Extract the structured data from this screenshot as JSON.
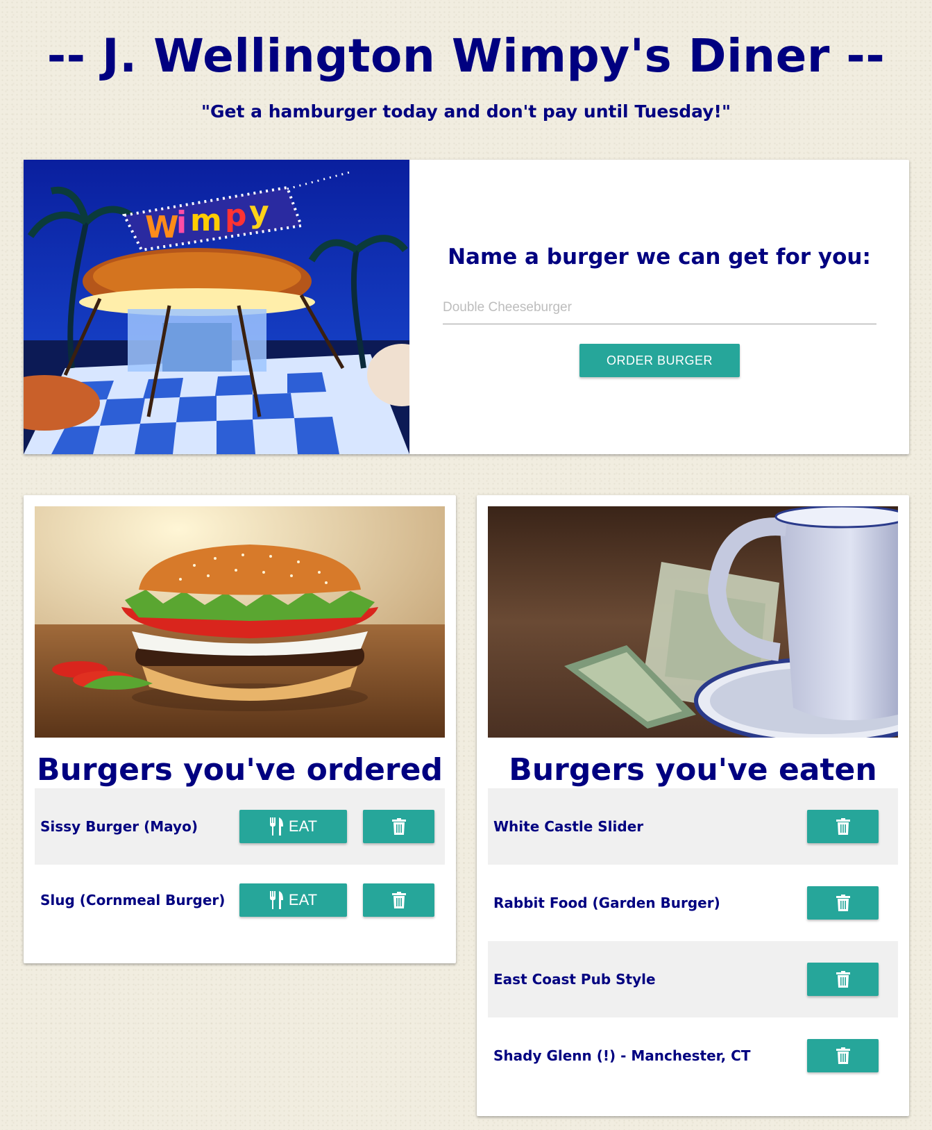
{
  "header": {
    "title": "-- J. Wellington Wimpy's Diner --",
    "tagline": "\"Get a hamburger today and don't pay until Tuesday!\""
  },
  "order_form": {
    "heading": "Name a burger we can get for you:",
    "input_value": "",
    "input_placeholder": "Double Cheeseburger",
    "button_label": "ORDER BURGER"
  },
  "ordered": {
    "title": "Burgers you've ordered",
    "items": [
      {
        "name": "Sissy Burger (Mayo)"
      },
      {
        "name": "Slug (Cornmeal Burger)"
      }
    ],
    "eat_label": "EAT"
  },
  "eaten": {
    "title": "Burgers you've eaten",
    "items": [
      {
        "name": "White Castle Slider"
      },
      {
        "name": "Rabbit Food (Garden Burger)"
      },
      {
        "name": "East Coast Pub Style"
      },
      {
        "name": "Shady Glenn (!) - Manchester, CT"
      }
    ]
  },
  "icons": {
    "eat": "utensils-icon",
    "delete": "trash-icon"
  },
  "colors": {
    "text": "#000080",
    "accent": "#26a69a",
    "background": "#f1ede0",
    "row_shade": "#f0f0f0"
  }
}
